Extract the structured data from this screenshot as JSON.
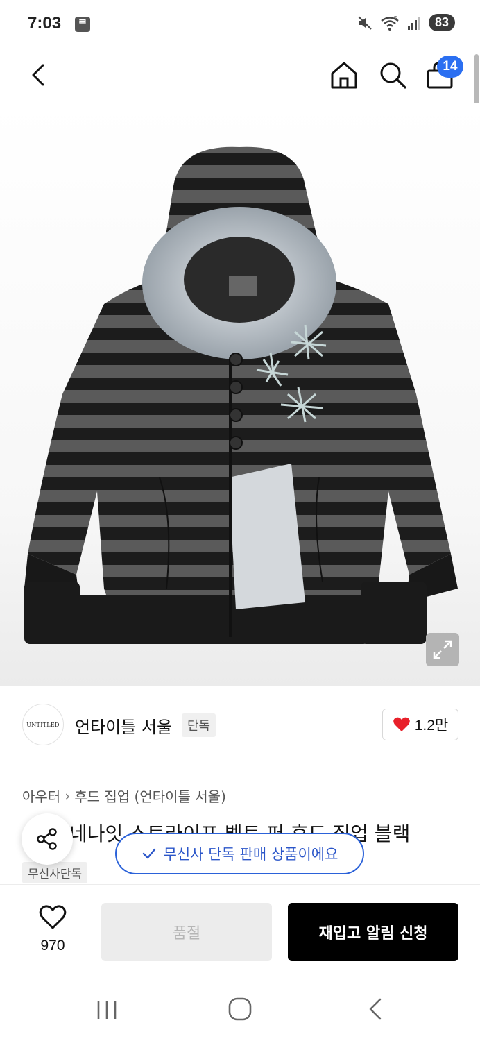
{
  "status_bar": {
    "time": "7:03",
    "app_icon_glyph": "ᄅ",
    "battery": "83",
    "network": "5"
  },
  "header": {
    "cart_count": "14"
  },
  "product": {
    "category": [
      "아우터",
      "후드 집업 (언타이틀 서울)"
    ],
    "title": "네나잇 스트라이프 벨트 퍼 후드 집업 블랙",
    "exclusive_tag": "무신사단독"
  },
  "brand": {
    "logo_text": "UNTITLED",
    "name": "언타이틀 서울",
    "tag": "단독",
    "like_count": "1.2만"
  },
  "toast": {
    "text": "무신사 단독 판매 상품이에요"
  },
  "actions": {
    "wish_count": "970",
    "soldout_label": "품절",
    "restock_label": "재입고 알림 신청"
  },
  "colors": {
    "accent_blue": "#2b6ff1",
    "heart_red": "#e8202a",
    "primary_black": "#000000"
  }
}
